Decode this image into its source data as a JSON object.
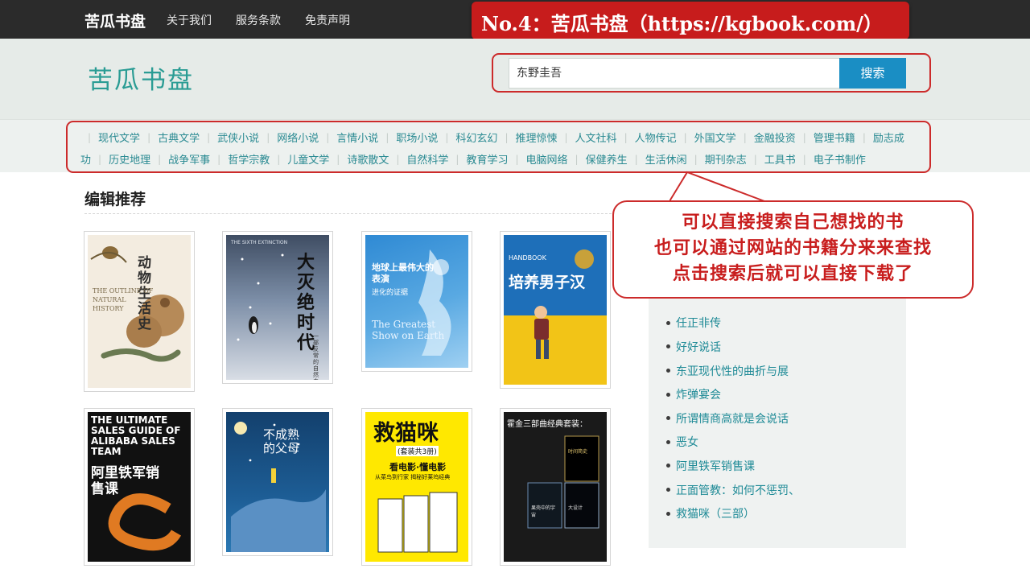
{
  "topnav": {
    "brand": "苦瓜书盘",
    "links": [
      "关于我们",
      "服务条款",
      "免责声明"
    ]
  },
  "promo_banner": "No.4：苦瓜书盘（https://kgbook.com/）",
  "header": {
    "logo": "苦瓜书盘",
    "search_value": "东野圭吾",
    "search_button": "搜索"
  },
  "categories": {
    "row1": [
      "现代文学",
      "古典文学",
      "武侠小说",
      "网络小说",
      "言情小说",
      "职场小说",
      "科幻玄幻",
      "推理惊悚",
      "人文社科",
      "人物传记",
      "外国文学",
      "金融投资",
      "管理书籍",
      "励志成"
    ],
    "row2": [
      "功",
      "历史地理",
      "战争军事",
      "哲学宗教",
      "儿童文学",
      "诗歌散文",
      "自然科学",
      "教育学习",
      "电脑网络",
      "保健养生",
      "生活休闲",
      "期刊杂志",
      "工具书",
      "电子书制作"
    ]
  },
  "editor_picks": {
    "title": "编辑推荐",
    "books": [
      {
        "title": "动物生活史",
        "en": "THE OUTLINE OF NATURAL HISTORY"
      },
      {
        "title": "大灭绝时代",
        "subtitle": "一部反常的自然史",
        "en": "THE SIXTH EXTINCTION"
      },
      {
        "title": "地球上最伟大的表演",
        "subtitle": "进化的证据",
        "en": "The Greatest Show on Earth"
      },
      {
        "title": "培养男子汉",
        "en": "HANDBOOK"
      },
      {
        "title": "阿里铁军销售课",
        "en": "THE ULTIMATE SALES GUIDE OF ALIBABA SALES TEAM"
      },
      {
        "title": "不成熟的父母"
      },
      {
        "title": "救猫咪",
        "subtitle": "(套装共3册)",
        "tagline": "看电影·懂电影",
        "tagline2": "从菜鸟到行家 揭秘好莱坞经典"
      },
      {
        "title": "霍金三部曲经典套装：",
        "sub1": "时间简史",
        "sub2": "大设计",
        "sub3": "果壳中的宇宙"
      }
    ]
  },
  "sidebar": {
    "items": [
      "任正非传",
      "好好说话",
      "东亚现代性的曲折与展",
      "炸弹宴会",
      "所谓情商高就是会说话",
      "恶女",
      "阿里铁军销售课",
      "正面管教：如何不惩罚、",
      "救猫咪（三部）"
    ]
  },
  "callout": {
    "lines": [
      "可以直接搜索自己想找的书",
      "也可以通过网站的书籍分来来查找",
      "点击搜索后就可以直接下载了"
    ]
  },
  "colors": {
    "brand_teal": "#2a9c94",
    "link_teal": "#2a8a92",
    "button_blue": "#1a8ec4",
    "annotation_red": "#cc2b2b"
  }
}
